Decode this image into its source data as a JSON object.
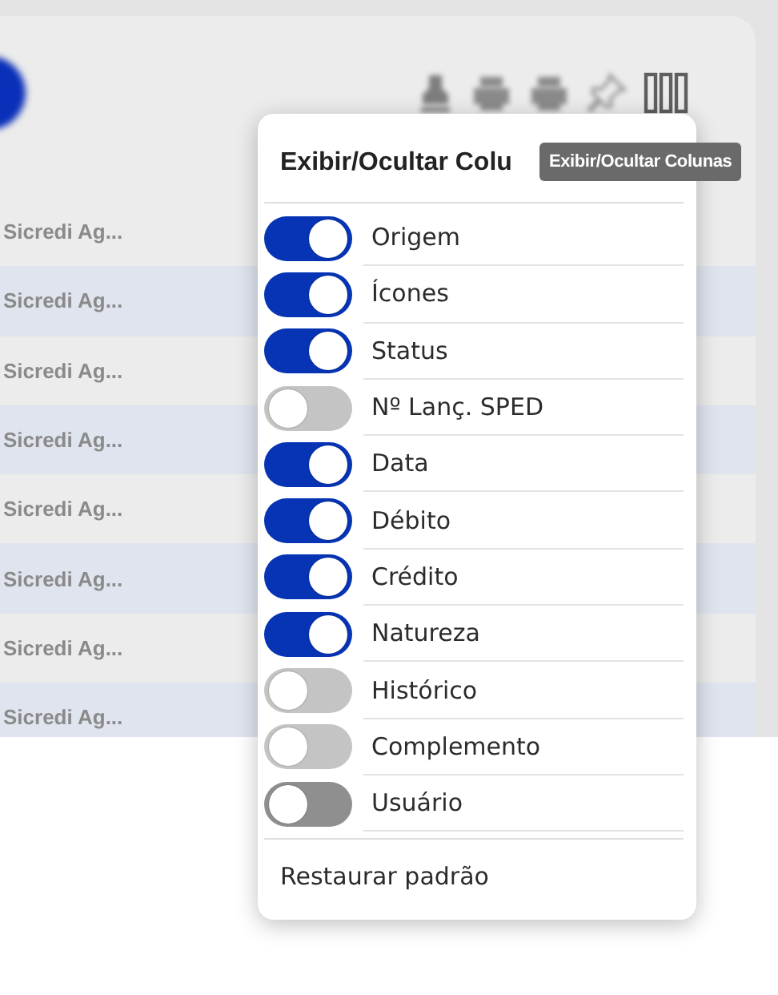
{
  "background_table": {
    "rows": [
      {
        "column_1": "Sicredi Ag..."
      },
      {
        "column_1": "Sicredi Ag..."
      },
      {
        "column_1": "Sicredi Ag..."
      },
      {
        "column_1": "Sicredi Ag..."
      },
      {
        "column_1": "Sicredi Ag..."
      },
      {
        "column_1": "Sicredi Ag..."
      },
      {
        "column_1": "Sicredi Ag..."
      },
      {
        "column_1": "Sicredi Ag..."
      }
    ]
  },
  "tooltip": {
    "text": "Exibir/Ocultar Colunas"
  },
  "column_menu": {
    "title": "Exibir/Ocultar Colu",
    "items": [
      {
        "label": "Origem",
        "on": true,
        "color": "#0634b4"
      },
      {
        "label": "Ícones",
        "on": true,
        "color": "#0634b4"
      },
      {
        "label": "Status",
        "on": true,
        "color": "#0634b4"
      },
      {
        "label": "Nº Lanç. SPED",
        "on": false,
        "color": "#c4c4c4"
      },
      {
        "label": "Data",
        "on": true,
        "color": "#0634b4"
      },
      {
        "label": "Débito",
        "on": true,
        "color": "#0634b4"
      },
      {
        "label": "Crédito",
        "on": true,
        "color": "#0634b4"
      },
      {
        "label": "Natureza",
        "on": true,
        "color": "#0634b4"
      },
      {
        "label": "Histórico",
        "on": false,
        "color": "#c4c4c4"
      },
      {
        "label": "Complemento",
        "on": false,
        "color": "#c4c4c4"
      },
      {
        "label": "Usuário",
        "on": false,
        "color": "#8f8f8f"
      }
    ],
    "reset_label": "Restaurar padrão"
  }
}
